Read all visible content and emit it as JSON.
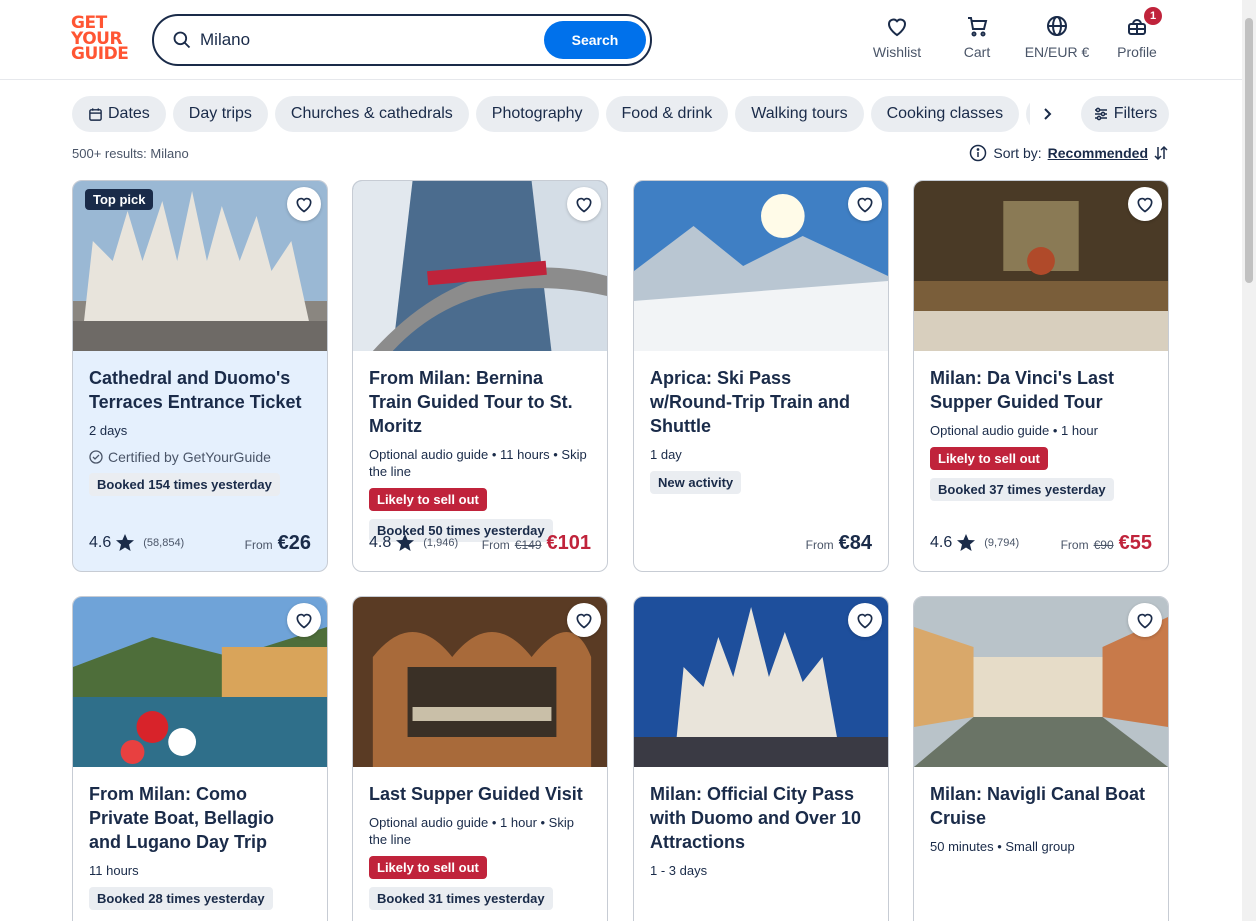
{
  "logo": {
    "line1": "GET",
    "line2": "YOUR",
    "line3": "GUIDE"
  },
  "search": {
    "value": "Milano",
    "button": "Search"
  },
  "header_nav": [
    {
      "label": "Wishlist",
      "icon": "heart-icon"
    },
    {
      "label": "Cart",
      "icon": "cart-icon"
    },
    {
      "label": "EN/EUR €",
      "icon": "globe-icon"
    },
    {
      "label": "Profile",
      "icon": "profile-icon",
      "badge": "1"
    }
  ],
  "chips": [
    "Dates",
    "Day trips",
    "Churches & cathedrals",
    "Photography",
    "Food & drink",
    "Walking tours",
    "Cooking classes"
  ],
  "filters_label": "Filters",
  "results_text": "500+ results: Milano",
  "sort": {
    "label": "Sort by:",
    "value": "Recommended"
  },
  "cards": [
    {
      "title": "Cathedral and Duomo's Terraces Entrance Ticket",
      "badge": "Top pick",
      "meta": "2 days",
      "certified": "Certified by GetYourGuide",
      "booked": "Booked 154 times yesterday",
      "rating": "4.6",
      "reviews": "(58,854)",
      "from": "From",
      "price": "€26"
    },
    {
      "title": "From Milan: Bernina Train Guided Tour to St. Moritz",
      "meta": "Optional audio guide • 11 hours • Skip the line",
      "sellout": "Likely to sell out",
      "booked": "Booked 50 times yesterday",
      "rating": "4.8",
      "reviews": "(1,946)",
      "from": "From",
      "old_price": "€149",
      "price": "€101"
    },
    {
      "title": "Aprica: Ski Pass w/Round-Trip Train and Shuttle",
      "meta": "1 day",
      "new": "New activity",
      "from": "From",
      "price": "€84"
    },
    {
      "title": "Milan: Da Vinci's Last Supper Guided Tour",
      "meta": "Optional audio guide • 1 hour",
      "sellout": "Likely to sell out",
      "booked": "Booked 37 times yesterday",
      "rating": "4.6",
      "reviews": "(9,794)",
      "from": "From",
      "old_price": "€90",
      "price": "€55"
    },
    {
      "title": "From Milan: Como Private Boat, Bellagio and Lugano Day Trip",
      "meta": "11 hours",
      "booked": "Booked 28 times yesterday"
    },
    {
      "title": "Last Supper Guided Visit",
      "meta": "Optional audio guide • 1 hour • Skip the line",
      "sellout": "Likely to sell out",
      "booked": "Booked 31 times yesterday"
    },
    {
      "title": "Milan: Official City Pass with Duomo and Over 10 Attractions",
      "meta": "1 - 3 days"
    },
    {
      "title": "Milan: Navigli Canal Boat Cruise",
      "meta": "50 minutes • Small group"
    }
  ],
  "colors": {
    "brand": "#ff5533",
    "primary": "#0071eb",
    "navy": "#1a2b49",
    "sale": "#c0233b",
    "highlight": "#e5f0fd"
  }
}
